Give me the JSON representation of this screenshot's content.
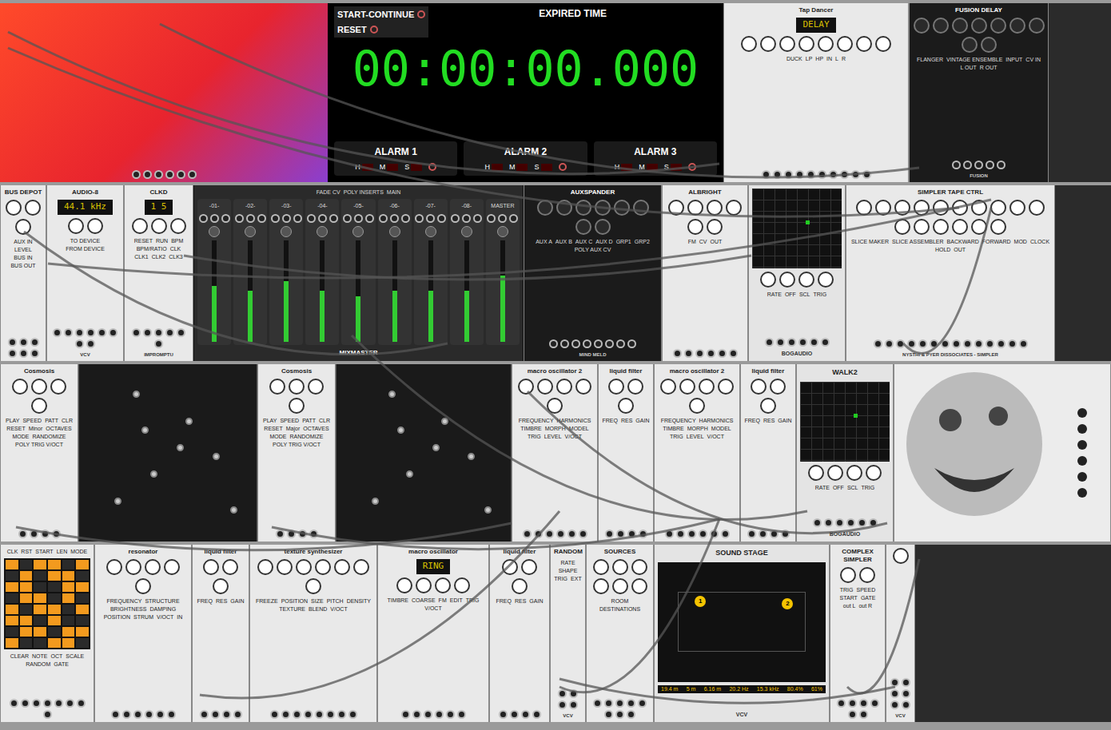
{
  "rows": [
    [
      {
        "kind": "visual"
      },
      {
        "kind": "timer",
        "buttons": [
          "START-CONTINUE",
          "RESET"
        ],
        "title": "EXPIRED TIME",
        "time": "00:00:00.000",
        "alarms": [
          {
            "label": "ALARM 1",
            "fields": [
              "H",
              "M",
              "S"
            ]
          },
          {
            "label": "ALARM 2",
            "fields": [
              "H",
              "M",
              "S"
            ]
          },
          {
            "label": "ALARM 3",
            "fields": [
              "H",
              "M",
              "S"
            ]
          }
        ]
      },
      {
        "kind": "light-panel",
        "name": "Tap Dancer",
        "display": "DELAY",
        "labels": [
          "DUCK",
          "LP",
          "HP",
          "IN",
          "L",
          "R"
        ]
      },
      {
        "kind": "dark-panel",
        "name": "FUSION DELAY",
        "labels": [
          "FLANGER",
          "VINTAGE ENSEMBLE",
          "INPUT",
          "CV IN",
          "L OUT",
          "R OUT"
        ],
        "brand": "FUSION"
      },
      {
        "kind": "empty"
      }
    ],
    [
      {
        "kind": "light-panel",
        "name": "BUS DEPOT",
        "labels": [
          "AUX IN",
          "LEVEL",
          "BUS IN",
          "BUS OUT"
        ]
      },
      {
        "kind": "light-panel",
        "name": "AUDIO-8",
        "display": "44.1 kHz",
        "labels": [
          "TO DEVICE",
          "FROM DEVICE"
        ],
        "brand": "VCV"
      },
      {
        "kind": "light-panel",
        "name": "CLKD",
        "display": "1 5",
        "labels": [
          "RESET",
          "RUN",
          "BPM",
          "BPM/RATIO",
          "CLK",
          "CLK1",
          "CLK2",
          "CLK3"
        ],
        "brand": "IMPROMPTU"
      },
      {
        "kind": "mixer",
        "name": "MIXMASTER",
        "tracks": [
          {
            "label": "-01-",
            "level": 0.55
          },
          {
            "label": "-02-",
            "level": 0.5
          },
          {
            "label": "-03-",
            "level": 0.6
          },
          {
            "label": "-04-",
            "level": 0.5
          },
          {
            "label": "-05-",
            "level": 0.45
          },
          {
            "label": "-06-",
            "level": 0.5
          },
          {
            "label": "-07-",
            "level": 0.5
          },
          {
            "label": "-08-",
            "level": 0.5
          }
        ],
        "master": {
          "label": "MASTER",
          "level": 0.65
        },
        "labels": [
          "FADE CV",
          "POLY INSERTS",
          "MAIN"
        ],
        "brand": "MIND MELD"
      },
      {
        "kind": "dark-panel",
        "name": "AUXSPANDER",
        "labels": [
          "AUX A",
          "AUX B",
          "AUX C",
          "AUX D",
          "GRP1",
          "GRP2",
          "POLY AUX CV"
        ],
        "brand": "MIND MELD"
      },
      {
        "kind": "light-panel",
        "name": "ALBRIGHT",
        "labels": [
          "FM",
          "CV",
          "OUT"
        ]
      },
      {
        "kind": "scope",
        "name": "",
        "labels": [
          "RATE",
          "OFF",
          "SCL",
          "TRIG"
        ],
        "brand": "BOGAUDIO"
      },
      {
        "kind": "light-panel",
        "name": "SIMPLER TAPE CTRL",
        "labels": [
          "SLICE MAKER",
          "SLICE ASSEMBLER",
          "BACKWARD",
          "FORWARD",
          "MOD",
          "CLOCK",
          "HOLD",
          "OUT"
        ],
        "brand": "NYSTHI & PYER DISSOCIATES - SIMPLER"
      },
      {
        "kind": "empty"
      }
    ],
    [
      {
        "kind": "light-panel",
        "name": "Cosmosis",
        "labels": [
          "PLAY",
          "SPEED",
          "PATT",
          "CLR",
          "RESET",
          "Minor",
          "OCTAVES",
          "MODE",
          "RANDOMIZE",
          "POLY TRIG V/OCT"
        ]
      },
      {
        "kind": "space"
      },
      {
        "kind": "light-panel",
        "name": "Cosmosis",
        "labels": [
          "PLAY",
          "SPEED",
          "PATT",
          "CLR",
          "RESET",
          "Major",
          "OCTAVES",
          "MODE",
          "RANDOMIZE",
          "POLY TRIG V/OCT"
        ]
      },
      {
        "kind": "space"
      },
      {
        "kind": "light-panel",
        "name": "macro oscillator 2",
        "labels": [
          "FREQUENCY",
          "HARMONICS",
          "TIMBRE",
          "MORPH",
          "MODEL",
          "TRIG",
          "LEVEL",
          "V/OCT"
        ]
      },
      {
        "kind": "light-panel",
        "name": "liquid filter",
        "labels": [
          "FREQ",
          "RES",
          "GAIN"
        ]
      },
      {
        "kind": "light-panel",
        "name": "macro oscillator 2",
        "labels": [
          "FREQUENCY",
          "HARMONICS",
          "TIMBRE",
          "MORPH",
          "MODEL",
          "TRIG",
          "LEVEL",
          "V/OCT"
        ]
      },
      {
        "kind": "light-panel",
        "name": "liquid filter",
        "labels": [
          "FREQ",
          "RES",
          "GAIN"
        ]
      },
      {
        "kind": "scope",
        "name": "WALK2",
        "labels": [
          "RATE",
          "OFF",
          "SCL",
          "TRIG"
        ],
        "brand": "BOGAUDIO"
      },
      {
        "kind": "art"
      }
    ],
    [
      {
        "kind": "sequencer",
        "top": [
          "CLK",
          "RST",
          "START",
          "LEN",
          "MODE"
        ],
        "bottom": [
          "CLEAR",
          "NOTE",
          "OCT",
          "SCALE",
          "RANDOM",
          "GATE"
        ],
        "grid": [
          [
            true,
            false,
            true,
            true,
            false,
            true
          ],
          [
            false,
            true,
            false,
            true,
            true,
            false
          ],
          [
            true,
            true,
            false,
            false,
            true,
            true
          ],
          [
            false,
            true,
            true,
            false,
            true,
            false
          ],
          [
            true,
            false,
            true,
            true,
            false,
            true
          ],
          [
            true,
            true,
            false,
            true,
            false,
            false
          ],
          [
            false,
            true,
            true,
            false,
            true,
            true
          ],
          [
            true,
            false,
            false,
            true,
            true,
            false
          ]
        ]
      },
      {
        "kind": "light-panel",
        "name": "resonator",
        "labels": [
          "FREQUENCY",
          "STRUCTURE",
          "BRIGHTNESS",
          "DAMPING",
          "POSITION",
          "STRUM",
          "V/OCT",
          "IN"
        ]
      },
      {
        "kind": "light-panel",
        "name": "liquid filter",
        "labels": [
          "FREQ",
          "RES",
          "GAIN"
        ]
      },
      {
        "kind": "light-panel",
        "name": "texture synthesizer",
        "labels": [
          "FREEZE",
          "POSITION",
          "SIZE",
          "PITCH",
          "DENSITY",
          "TEXTURE",
          "BLEND",
          "V/OCT"
        ]
      },
      {
        "kind": "light-panel",
        "name": "macro oscillator",
        "display": "RING",
        "labels": [
          "TIMBRE",
          "COARSE",
          "FM",
          "EDIT",
          "TRIG",
          "V/OCT"
        ]
      },
      {
        "kind": "light-panel",
        "name": "liquid filter",
        "labels": [
          "FREQ",
          "RES",
          "GAIN"
        ]
      },
      {
        "kind": "light-panel",
        "name": "RANDOM",
        "labels": [
          "RATE",
          "SHAPE",
          "TRIG",
          "EXT"
        ],
        "brand": "VCV"
      },
      {
        "kind": "light-panel",
        "name": "SOURCES",
        "labels": [
          "ROOM",
          "DESTINATIONS"
        ]
      },
      {
        "kind": "stage",
        "name": "SOUND STAGE",
        "sources": [
          "1",
          "2"
        ],
        "readouts": [
          "19.4 m",
          "5 m",
          "6.16 m",
          "20.2 Hz",
          "15.3 kHz",
          "80.4%",
          "61%"
        ],
        "brand": "VCV"
      },
      {
        "kind": "light-panel",
        "name": "COMPLEX SIMPLER",
        "labels": [
          "TRIG",
          "SPEED",
          "START",
          "GATE",
          "out L",
          "out R"
        ]
      },
      {
        "kind": "light-panel",
        "name": "",
        "labels": [],
        "brand": "VCV"
      },
      {
        "kind": "empty"
      }
    ]
  ]
}
